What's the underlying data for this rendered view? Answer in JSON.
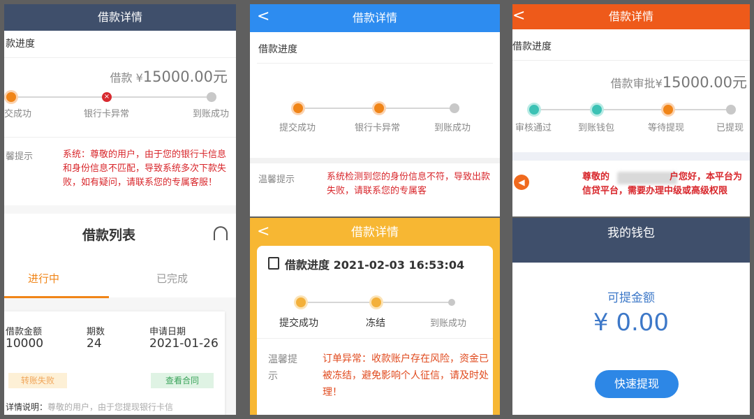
{
  "panel1": {
    "header_title": "借款详情",
    "progress_title": "款进度",
    "amount_label": "借款 ¥",
    "amount_value": "15000.00元",
    "steps": [
      "交成功",
      "银行卡异常",
      "到账成功"
    ],
    "notice_label": "馨提示",
    "notice_text": "系统：尊敬的用户，由于您的银行卡信息和身份信息不匹配，导致系统多次下款失败，如有疑问，请联系您的专属客服！",
    "list_title": "借款列表",
    "tabs": [
      "进行中",
      "已完成"
    ],
    "card": {
      "amount_label": "借款金额",
      "amount_value": "10000",
      "periods_label": "期数",
      "periods_value": "24",
      "date_label": "申请日期",
      "date_value": "2021-01-26",
      "status_badge": "转账失败",
      "contract_button": "查看合同",
      "detail_label": "详情说明：",
      "detail_text": "尊敬的用户，由于您提现银行卡信"
    }
  },
  "panel2": {
    "header_title": "借款详情",
    "back_glyph": "<",
    "progress_title": "借款进度",
    "steps": [
      "提交成功",
      "银行卡异常",
      "到账成功"
    ],
    "notice_label": "温馨提示",
    "notice_text": "系统检测到您的身份信息不符，导致出款失败，请联系您的专属客"
  },
  "panel3": {
    "header_title": "借款详情",
    "back_glyph": "<",
    "progress_title": "借款进度 2021-02-03 16:53:04",
    "steps": [
      "提交成功",
      "冻结",
      "到账成功"
    ],
    "notice_label_1": "温馨提",
    "notice_label_2": "示",
    "notice_text": "订单异常：收款账户存在风险，资金已被冻结，避免影响个人征信，请及时处理！"
  },
  "panel4": {
    "header_title": "借款详情",
    "back_glyph": "<",
    "progress_title": "借款进度",
    "amount_label": "借款审批¥",
    "amount_value": "15000.00元",
    "steps": [
      "审核通过",
      "到账钱包",
      "等待提现",
      "已提现"
    ],
    "notice_prefix": "尊敬的",
    "notice_suffix": "户您好，本平台为信贷平台，需要办理中级或高级权限"
  },
  "panel5": {
    "header_title": "我的钱包",
    "balance_label": "可提金额",
    "balance_value": "¥ 0.00",
    "withdraw_button": "快速提现"
  },
  "colors": {
    "navy": "#3f4f6b",
    "blue": "#2d8cf0",
    "orange_red": "#ee5a1a",
    "gold": "#f7b733",
    "wallet_blue": "#3d78c8",
    "button_blue": "#2d87e6"
  }
}
